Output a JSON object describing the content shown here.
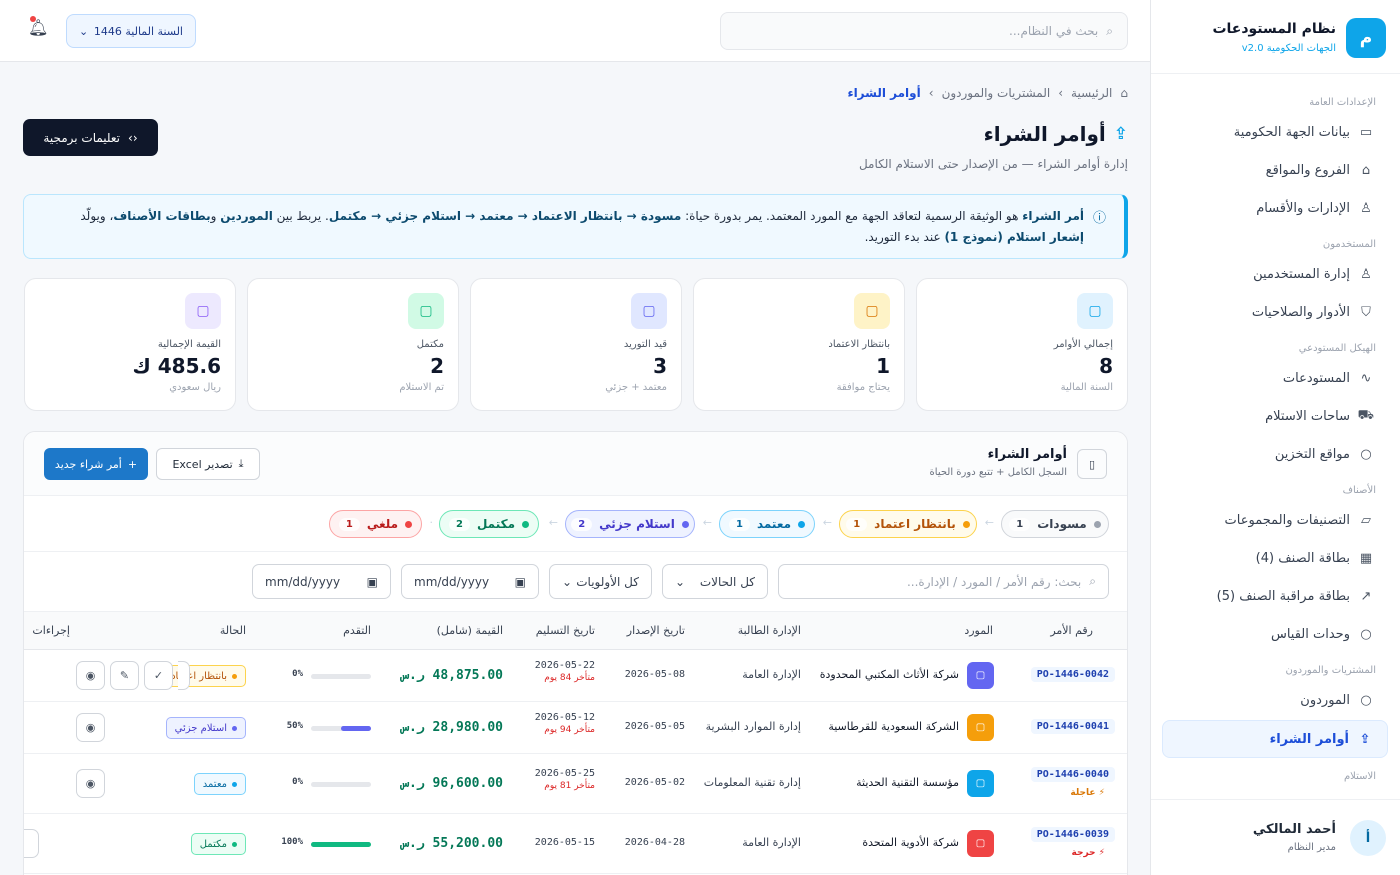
{
  "sidebar": {
    "brand_logo": "م",
    "brand_title": "نظام المستودعات",
    "brand_sub": "الجهات الحكومية v2.0",
    "sections": {
      "general": "الإعدادات العامة",
      "users": "المستخدمون",
      "structure": "الهيكل المستودعي",
      "items": "الأصناف",
      "procurement": "المشتريات والموردون",
      "receiving": "الاستلام"
    },
    "items": [
      {
        "label": "بيانات الجهة الحكومية",
        "icon": "monitor-icon"
      },
      {
        "label": "الفروع والمواقع",
        "icon": "home-icon"
      },
      {
        "label": "الإدارات والأقسام",
        "icon": "user-icon"
      },
      {
        "label": "إدارة المستخدمين",
        "icon": "user-icon"
      },
      {
        "label": "الأدوار والصلاحيات",
        "icon": "shield-icon"
      },
      {
        "label": "المستودعات",
        "icon": "activity-icon"
      },
      {
        "label": "ساحات الاستلام",
        "icon": "truck-icon"
      },
      {
        "label": "مواقع التخزين",
        "icon": "circle-icon"
      },
      {
        "label": "التصنيفات والمجموعات",
        "icon": "folder-icon"
      },
      {
        "label": "بطاقة الصنف (4)",
        "icon": "table-icon"
      },
      {
        "label": "بطاقة مراقبة الصنف (5)",
        "icon": "chart-icon"
      },
      {
        "label": "وحدات القياس",
        "icon": "circle-icon"
      },
      {
        "label": "الموردون",
        "icon": "circle-icon"
      },
      {
        "label": "أوامر الشراء",
        "icon": "upload-icon"
      }
    ],
    "user": {
      "initial": "أ",
      "name": "أحمد المالكي",
      "role": "مدير النظام"
    }
  },
  "topbar": {
    "search_placeholder": "بحث في النظام...",
    "fiscal_year": "السنة المالية 1446"
  },
  "breadcrumb": {
    "home": "الرئيسية",
    "section": "المشتريات والموردون",
    "current": "أوامر الشراء"
  },
  "page": {
    "title": "أوامر الشراء",
    "subtitle": "إدارة أوامر الشراء — من الإصدار حتى الاستلام الكامل",
    "dev_button": "تعليمات برمجية"
  },
  "info": {
    "t1": "أمر الشراء",
    "t2": " هو الوثيقة الرسمية لتعاقد الجهة مع المورد المعتمد. يمر بدورة حياة: ",
    "t3": "مسودة → بانتظار الاعتماد → معتمد → استلام جزئي → مكتمل",
    "t4": ". يربط بين ",
    "t5": "الموردين",
    "t6": " و",
    "t7": "بطاقات الأصناف",
    "t8": "، ويولّد ",
    "t9": "إشعار استلام (نموذج 1)",
    "t10": " عند بدء التوريد."
  },
  "stats": [
    {
      "label": "إجمالي الأوامر",
      "value": "8",
      "note": "السنة المالية",
      "color": "#0ea5e9",
      "bg": "#e0f2fe"
    },
    {
      "label": "بانتظار الاعتماد",
      "value": "1",
      "note": "يحتاج موافقة",
      "color": "#d97706",
      "bg": "#fef3c7"
    },
    {
      "label": "قيد التوريد",
      "value": "3",
      "note": "معتمد + جزئي",
      "color": "#6366f1",
      "bg": "#e0e7ff"
    },
    {
      "label": "مكتمل",
      "value": "2",
      "note": "تم الاستلام",
      "color": "#10b981",
      "bg": "#d1fae5"
    },
    {
      "label": "القيمة الإجمالية",
      "value": "485.6 ك",
      "note": "ريال سعودي",
      "color": "#8b5cf6",
      "bg": "#ede9fe"
    }
  ],
  "panel": {
    "title": "أوامر الشراء",
    "subtitle": "السجل الكامل + تتبع دورة الحياة",
    "new_button": "أمر شراء جديد",
    "export_button": "تصدير Excel"
  },
  "pipeline": [
    {
      "label": "مسودات",
      "count": "1",
      "color": "#9ca3af",
      "bg": "#f9fafb",
      "border": "#d1d5db",
      "text": "#374151"
    },
    {
      "label": "بانتظار اعتماد",
      "count": "1",
      "color": "#f59e0b",
      "bg": "#fffbeb",
      "border": "#fcd34d",
      "text": "#b45309"
    },
    {
      "label": "معتمد",
      "count": "1",
      "color": "#0ea5e9",
      "bg": "#f0f9ff",
      "border": "#7dd3fc",
      "text": "#0369a1"
    },
    {
      "label": "استلام جزئي",
      "count": "2",
      "color": "#6366f1",
      "bg": "#eef2ff",
      "border": "#a5b4fc",
      "text": "#4338ca"
    },
    {
      "label": "مكتمل",
      "count": "2",
      "color": "#10b981",
      "bg": "#ecfdf5",
      "border": "#6ee7b7",
      "text": "#047857"
    },
    {
      "label": "ملغي",
      "count": "1",
      "color": "#ef4444",
      "bg": "#fef2f2",
      "border": "#fca5a5",
      "text": "#b91c1c"
    }
  ],
  "filters": {
    "search_placeholder": "بحث: رقم الأمر / المورد / الإدارة...",
    "status": "كل الحالات",
    "priority": "كل الأولويات",
    "date_from": "mm/dd/yyyy",
    "date_to": "mm/dd/yyyy"
  },
  "columns": [
    "رقم الأمر",
    "المورد",
    "الإدارة الطالبة",
    "تاريخ الإصدار",
    "تاريخ التسليم",
    "القيمة (شامل)",
    "التقدم",
    "الحالة",
    "إجراءات"
  ],
  "rows": [
    {
      "po": "PO-1446-0042",
      "priority": "",
      "vendor": "شركة الأثاث المكتبي المحدودة",
      "vcolor": "#6366f1",
      "dept": "الإدارة العامة",
      "issue": "2026-05-08",
      "delivery": "2026-05-22",
      "late": "متأخر 84 يوم",
      "amount": "48,875.00 ر.س",
      "progress": 0,
      "pct": "0%",
      "pcolor": "#6366f1",
      "status": "بانتظار اعتماد",
      "scolor": "#f59e0b",
      "sbg": "#fffbeb",
      "sborder": "#fcd34d",
      "stext": "#b45309"
    },
    {
      "po": "PO-1446-0041",
      "priority": "",
      "vendor": "الشركة السعودية للقرطاسية",
      "vcolor": "#f59e0b",
      "dept": "إدارة الموارد البشرية",
      "issue": "2026-05-05",
      "delivery": "2026-05-12",
      "late": "متأخر 94 يوم",
      "amount": "28,980.00 ر.س",
      "progress": 0.5,
      "pct": "50%",
      "pcolor": "#6366f1",
      "status": "استلام جزئي",
      "scolor": "#6366f1",
      "sbg": "#eef2ff",
      "sborder": "#a5b4fc",
      "stext": "#4338ca"
    },
    {
      "po": "PO-1446-0040",
      "priority": "⚡ عاجلة",
      "pricolor": "#d97706",
      "vendor": "مؤسسة التقنية الحديثة",
      "vcolor": "#0ea5e9",
      "dept": "إدارة تقنية المعلومات",
      "issue": "2026-05-02",
      "delivery": "2026-05-25",
      "late": "متأخر 81 يوم",
      "amount": "96,600.00 ر.س",
      "progress": 0,
      "pct": "0%",
      "pcolor": "#6366f1",
      "status": "معتمد",
      "scolor": "#0ea5e9",
      "sbg": "#f0f9ff",
      "sborder": "#7dd3fc",
      "stext": "#0369a1"
    },
    {
      "po": "PO-1446-0039",
      "priority": "⚡ حرجة",
      "pricolor": "#dc2626",
      "vendor": "شركة الأدوية المتحدة",
      "vcolor": "#ef4444",
      "dept": "الإدارة العامة",
      "issue": "2026-04-28",
      "delivery": "2026-05-15",
      "late": "",
      "amount": "55,200.00 ر.س",
      "progress": 1,
      "pct": "100%",
      "pcolor": "#10b981",
      "status": "مكتمل",
      "scolor": "#10b981",
      "sbg": "#ecfdf5",
      "sborder": "#6ee7b7",
      "stext": "#047857"
    }
  ]
}
